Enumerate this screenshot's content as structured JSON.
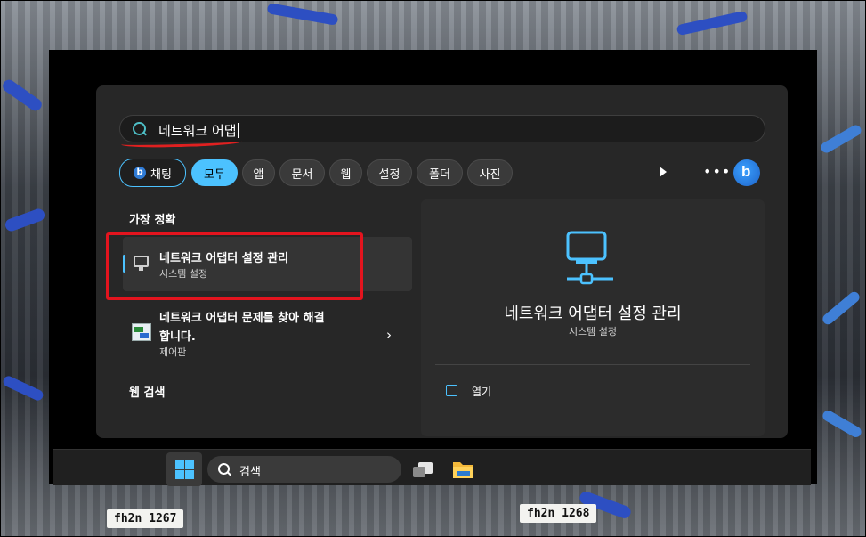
{
  "search": {
    "query": "네트워크 어댑"
  },
  "filters": [
    {
      "label": "채팅",
      "kind": "chat"
    },
    {
      "label": "모두",
      "kind": "active"
    },
    {
      "label": "앱"
    },
    {
      "label": "문서"
    },
    {
      "label": "웹"
    },
    {
      "label": "설정"
    },
    {
      "label": "폴더"
    },
    {
      "label": "사진"
    }
  ],
  "toolbar": {
    "more_label": "•••",
    "bing_letter": "b"
  },
  "results": {
    "best_match_heading": "가장 정확",
    "best_match": {
      "title": "네트워크 어댑터 설정 관리",
      "subtitle": "시스템 설정"
    },
    "second": {
      "title_line1": "네트워크 어댑터 문제를 찾아 해결",
      "title_line2": "합니다.",
      "subtitle": "제어판"
    },
    "web_heading": "웹 검색"
  },
  "preview": {
    "title": "네트워크 어댑터 설정 관리",
    "subtitle": "시스템 설정",
    "open_label": "열기"
  },
  "taskbar": {
    "search_label": "검색"
  },
  "background": {
    "tag_left": "fh2n 1267",
    "tag_right": "fh2n 1268"
  },
  "colors": {
    "accent": "#4cc2ff",
    "highlight_red": "#e3141e",
    "panel": "#272727"
  }
}
